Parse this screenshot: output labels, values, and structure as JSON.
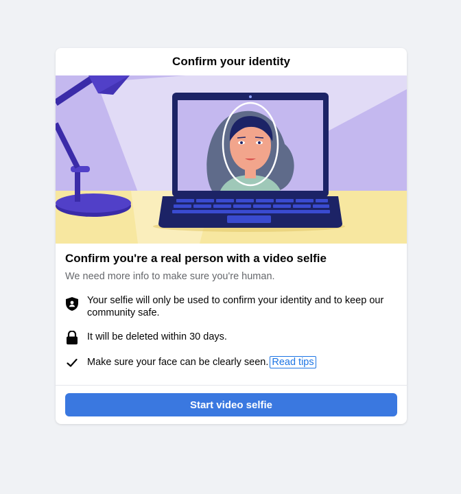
{
  "dialog": {
    "title": "Confirm your identity",
    "heading": "Confirm you're a real person with a video selfie",
    "subheading": "We need more info to make sure you're human.",
    "items": [
      {
        "icon": "shield-icon",
        "text": "Your selfie will only be used to confirm your identity and to keep our community safe."
      },
      {
        "icon": "lock-icon",
        "text": "It will be deleted within 30 days."
      },
      {
        "icon": "checkmark-icon",
        "text": "Make sure your face can be clearly seen."
      }
    ],
    "read_tips_label": "Read tips",
    "primary_button_label": "Start video selfie"
  },
  "colors": {
    "page_background": "#f0f2f5",
    "accent": "#3a78e0",
    "illustration_wall": "#c4b8ef",
    "illustration_desk": "#f7e7a0",
    "laptop": "#1c2366"
  }
}
